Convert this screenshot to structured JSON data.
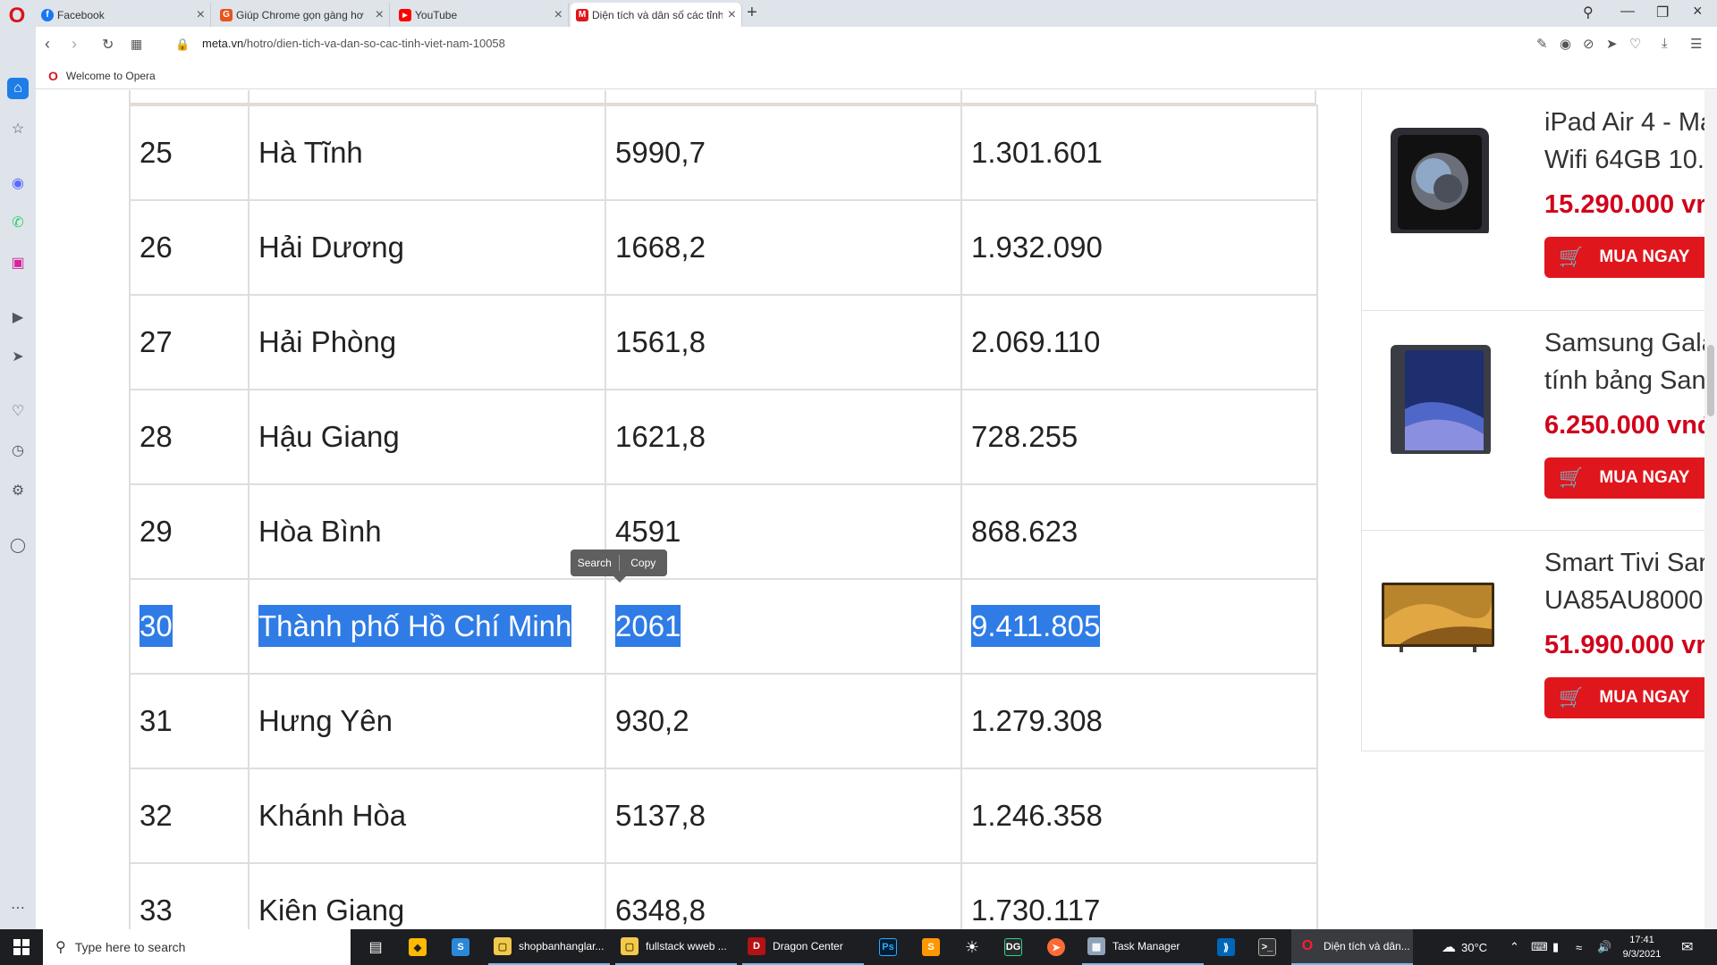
{
  "tabs": [
    {
      "title": "Facebook",
      "icon": "facebook-icon",
      "color": "#1877f2",
      "glyph": "f"
    },
    {
      "title": "Giúp Chrome gọn gàng hơ",
      "icon": "g-icon",
      "color": "#e8541b",
      "glyph": "G"
    },
    {
      "title": "YouTube",
      "icon": "youtube-icon",
      "color": "#ff0000",
      "glyph": "▶"
    },
    {
      "title": "Diện tích và dân số các tỉnh",
      "icon": "meta-icon",
      "color": "#e0161d",
      "glyph": "M"
    }
  ],
  "address": {
    "host": "meta.vn",
    "path": "/hotro/dien-tich-va-dan-so-cac-tinh-viet-nam-10058"
  },
  "bookmarks": {
    "welcome": "Welcome to Opera"
  },
  "table": {
    "rows": [
      {
        "no": "25",
        "name": "Hà Tĩnh",
        "area": "5990,7",
        "population": "1.301.601",
        "selected": false
      },
      {
        "no": "26",
        "name": "Hải Dương",
        "area": "1668,2",
        "population": "1.932.090",
        "selected": false
      },
      {
        "no": "27",
        "name": "Hải Phòng",
        "area": "1561,8",
        "population": "2.069.110",
        "selected": false
      },
      {
        "no": "28",
        "name": "Hậu Giang",
        "area": "1621,8",
        "population": "728.255",
        "selected": false
      },
      {
        "no": "29",
        "name": "Hòa Bình",
        "area": "4591",
        "population": "868.623",
        "selected": false
      },
      {
        "no": "30",
        "name": "Thành phố Hồ Chí Minh",
        "area": "2061",
        "population": "9.411.805",
        "selected": true
      },
      {
        "no": "31",
        "name": "Hưng Yên",
        "area": "930,2",
        "population": "1.279.308",
        "selected": false
      },
      {
        "no": "32",
        "name": "Khánh Hòa",
        "area": "5137,8",
        "population": "1.246.358",
        "selected": false
      },
      {
        "no": "33",
        "name": "Kiên Giang",
        "area": "6348,8",
        "population": "1.730.117",
        "selected": false
      }
    ]
  },
  "selection_popup": {
    "search": "Search",
    "copy": "Copy"
  },
  "products": [
    {
      "line1": "iPad Air 4 - Ma",
      "line2": "Wifi 64GB 10.",
      "price": "15.290.000 vr",
      "button": "MUA NGAY",
      "image": "ipad-image"
    },
    {
      "line1": "Samsung Gala",
      "line2": "tính bảng San",
      "price": "6.250.000 vnđ",
      "button": "MUA NGAY",
      "image": "tablet-image"
    },
    {
      "line1": "Smart Tivi Sar",
      "line2": "UA85AU8000",
      "price": "51.990.000 vr",
      "button": "MUA NGAY",
      "image": "tv-image"
    }
  ],
  "taskbar": {
    "search_placeholder": "Type here to search",
    "apps": [
      {
        "label": "shopbanhanglar...",
        "icon": "folder-icon"
      },
      {
        "label": "fullstack wweb ...",
        "icon": "folder-icon"
      },
      {
        "label": "Dragon Center",
        "icon": "dragon-icon"
      },
      {
        "label": "Task Manager",
        "icon": "task-manager-icon"
      },
      {
        "label": "Diện tích và dân...",
        "icon": "opera-icon"
      }
    ],
    "weather": "30°C",
    "time": "17:41",
    "date": "9/3/2021"
  },
  "colors": {
    "selection": "#2f7ce6",
    "buy_button": "#e0161d",
    "price": "#d0021b",
    "opera_red": "#d8141d"
  }
}
